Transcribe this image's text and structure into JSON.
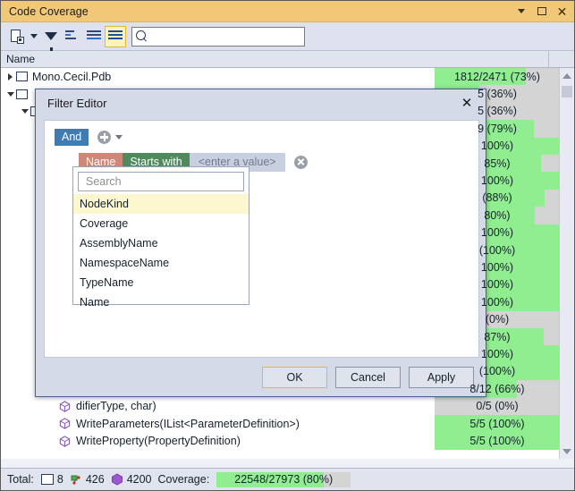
{
  "window": {
    "title": "Code Coverage",
    "buttons": {
      "dropdown": "▾",
      "maximize": "□",
      "close": "✕"
    }
  },
  "toolbar": {
    "report_icon": "report-lock-icon",
    "dropdown_icon": "chevron-down-icon",
    "filter_icon": "funnel-icon",
    "view_flat_icon": "list-flat-icon",
    "view_grouped_icon": "list-grouped-icon",
    "view_lines_icon": "list-lines-icon",
    "search": {
      "placeholder": "",
      "value": "",
      "icon": "search-icon"
    }
  },
  "grid": {
    "columns": [
      "Name",
      ""
    ],
    "rows": [
      {
        "indent": 0,
        "expander": "collapsed",
        "icon": "assembly-icon",
        "name": "Mono.Cecil.Pdb",
        "coverage": "1812/2471 (73%)",
        "percent": 73
      },
      {
        "indent": 0,
        "expander": "expanded",
        "icon": "assembly-icon",
        "name": "",
        "coverage": "5 (36%)",
        "percent": 36
      },
      {
        "indent": 1,
        "expander": "expanded",
        "icon": "namespace-icon",
        "name": "",
        "coverage": "5 (36%)",
        "percent": 36
      },
      {
        "indent": 2,
        "expander": "none",
        "icon": "type-icon",
        "name": "",
        "coverage": "9 (79%)",
        "percent": 79
      },
      {
        "indent": 3,
        "expander": "none",
        "icon": "method-icon",
        "name": "",
        "coverage": "100%)",
        "percent": 100
      },
      {
        "indent": 3,
        "expander": "none",
        "icon": "method-icon",
        "name": "",
        "coverage": "85%)",
        "percent": 85
      },
      {
        "indent": 3,
        "expander": "none",
        "icon": "method-icon",
        "name": "",
        "coverage": "100%)",
        "percent": 100
      },
      {
        "indent": 3,
        "expander": "none",
        "icon": "method-icon",
        "name": "",
        "coverage": "(88%)",
        "percent": 88
      },
      {
        "indent": 3,
        "expander": "none",
        "icon": "method-icon",
        "name": "",
        "coverage": "80%)",
        "percent": 80
      },
      {
        "indent": 3,
        "expander": "none",
        "icon": "method-icon",
        "name": "",
        "coverage": "100%)",
        "percent": 100
      },
      {
        "indent": 3,
        "expander": "none",
        "icon": "method-icon",
        "name": "",
        "coverage": "(100%)",
        "percent": 100
      },
      {
        "indent": 3,
        "expander": "none",
        "icon": "method-icon",
        "name": "",
        "coverage": "100%)",
        "percent": 100
      },
      {
        "indent": 3,
        "expander": "none",
        "icon": "method-icon",
        "name": "",
        "coverage": "100%)",
        "percent": 100
      },
      {
        "indent": 3,
        "expander": "none",
        "icon": "method-icon",
        "name": "",
        "coverage": "100%)",
        "percent": 100
      },
      {
        "indent": 3,
        "expander": "none",
        "icon": "method-icon",
        "name": "",
        "coverage": "(0%)",
        "percent": 0
      },
      {
        "indent": 3,
        "expander": "none",
        "icon": "method-icon",
        "name": "",
        "coverage": "87%)",
        "percent": 87
      },
      {
        "indent": 3,
        "expander": "none",
        "icon": "method-icon",
        "name": "",
        "coverage": "100%)",
        "percent": 100
      },
      {
        "indent": 3,
        "expander": "none",
        "icon": "method-icon",
        "name": "",
        "coverage": "(100%)",
        "percent": 100
      },
      {
        "indent": 3,
        "expander": "none",
        "icon": "method-icon",
        "name": "",
        "coverage": "8/12 (66%)",
        "percent": 66
      },
      {
        "indent": 3,
        "expander": "none",
        "icon": "method-icon",
        "name": "difierType, char)",
        "coverage": "0/5 (0%)",
        "percent": 0
      },
      {
        "indent": 3,
        "expander": "none",
        "icon": "method-icon",
        "name": "WriteParameters(IList<ParameterDefinition>)",
        "coverage": "5/5 (100%)",
        "percent": 100
      },
      {
        "indent": 3,
        "expander": "none",
        "icon": "method-icon",
        "name": "WriteProperty(PropertyDefinition)",
        "coverage": "5/5 (100%)",
        "percent": 100
      }
    ],
    "scrollbar": {
      "up_icon": "scroll-up-arrow-icon",
      "down_icon": "scroll-down-arrow-icon"
    }
  },
  "status": {
    "total_label": "Total:",
    "assembly_icon": "assembly-icon",
    "assembly_count": "8",
    "type_icon": "type-icon",
    "type_count": "426",
    "method_icon": "method-icon",
    "method_count": "4200",
    "coverage_label": "Coverage:",
    "coverage_value": "22548/27973 (80%)",
    "coverage_percent": 80
  },
  "dialog": {
    "title": "Filter Editor",
    "close_icon": "close-icon",
    "group_operator": "And",
    "add_icon": "plus-circle-icon",
    "add_caret_icon": "chevron-down-icon",
    "condition": {
      "field": "Name",
      "operator": "Starts with",
      "value_placeholder": "<enter a value>",
      "remove_icon": "remove-circle-icon"
    },
    "field_picker": {
      "search_placeholder": "Search",
      "search_value": "",
      "items": [
        {
          "label": "NodeKind",
          "selected": true
        },
        {
          "label": "Coverage",
          "selected": false
        },
        {
          "label": "AssemblyName",
          "selected": false
        },
        {
          "label": "NamespaceName",
          "selected": false
        },
        {
          "label": "TypeName",
          "selected": false
        },
        {
          "label": "Name",
          "selected": false
        }
      ]
    },
    "buttons": {
      "ok": "OK",
      "cancel": "Cancel",
      "apply": "Apply"
    }
  },
  "colors": {
    "titlebar": "#f0c878",
    "toolbar": "#dde2ee",
    "coverage_green": "#90ee90",
    "coverage_gray": "#d4d4d4",
    "chip_field": "#cf8878",
    "chip_operator": "#4f8a5c",
    "chip_and": "#3f7cb4"
  }
}
